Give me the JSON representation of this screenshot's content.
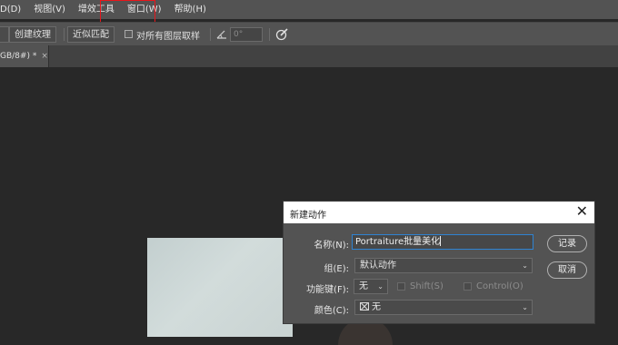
{
  "menubar": {
    "items": [
      "D(D)",
      "视图(V)",
      "增效工具",
      "窗口(W)",
      "帮助(H)"
    ]
  },
  "options": {
    "btn_create_texture": "创建纹理",
    "btn_proximity_match": "近似匹配",
    "sample_all_layers": "对所有图层取样",
    "angle_value": "0°"
  },
  "tab": {
    "label": "GB/8#) *",
    "close": "×"
  },
  "dialog": {
    "title": "新建动作",
    "close": "✕",
    "name_label": "名称(N):",
    "name_value": "Portraiture批量美化",
    "set_label": "组(E):",
    "set_value": "默认动作",
    "fkey_label": "功能键(F):",
    "fkey_value": "无",
    "shift_label": "Shift(S)",
    "control_label": "Control(O)",
    "color_label": "颜色(C):",
    "color_value": "无",
    "record_button": "记录",
    "cancel_button": "取消"
  }
}
